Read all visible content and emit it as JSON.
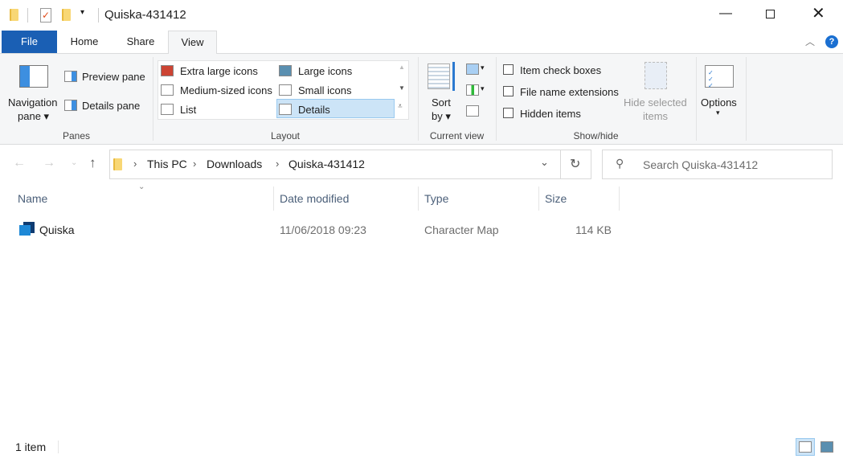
{
  "window": {
    "title": "Quiska-431412"
  },
  "tabs": [
    {
      "label": "File"
    },
    {
      "label": "Home"
    },
    {
      "label": "Share"
    },
    {
      "label": "View"
    }
  ],
  "ribbon": {
    "panes": {
      "navigation_pane": "Navigation",
      "navigation_pane2": "pane",
      "preview_pane": "Preview pane",
      "details_pane": "Details pane",
      "label": "Panes"
    },
    "layout": {
      "items": [
        "Extra large icons",
        "Large icons",
        "Medium-sized icons",
        "Small icons",
        "List",
        "Details"
      ],
      "selected": "Details",
      "label": "Layout"
    },
    "current_view": {
      "sort_by": "Sort",
      "sort_by2": "by",
      "label": "Current view"
    },
    "show_hide": {
      "item_check_boxes": "Item check boxes",
      "file_name_extensions": "File name extensions",
      "hidden_items": "Hidden items",
      "hide_selected": "Hide selected",
      "hide_selected2": "items",
      "label": "Show/hide"
    },
    "options": {
      "label": "Options"
    }
  },
  "address": {
    "crumbs": [
      "This PC",
      "Downloads",
      "Quiska-431412"
    ],
    "search_placeholder": "Search Quiska-431412"
  },
  "columns": [
    "Name",
    "Date modified",
    "Type",
    "Size"
  ],
  "files": [
    {
      "name": "Quiska",
      "date": "11/06/2018 09:23",
      "type": "Character Map",
      "size": "114 KB"
    }
  ],
  "status": {
    "count": "1 item"
  },
  "colors": {
    "file_tab": "#1a5fb4",
    "selected": "#cce4f7",
    "accent": "#0063b1"
  }
}
